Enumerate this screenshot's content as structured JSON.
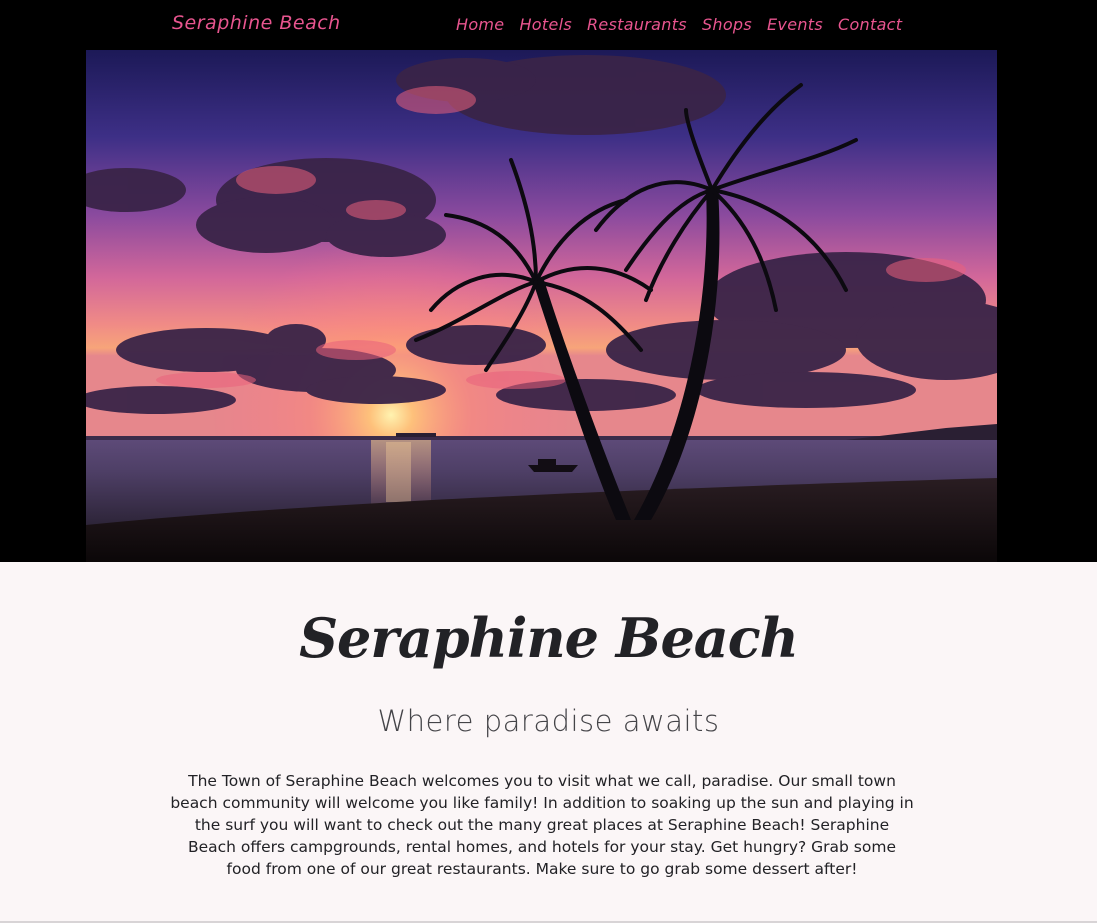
{
  "navbar": {
    "brand": "Seraphine Beach",
    "links": [
      "Home",
      "Hotels",
      "Restaurants",
      "Shops",
      "Events",
      "Contact"
    ]
  },
  "hero": {
    "image": "beach sunset with two palm trees"
  },
  "main": {
    "title": "Seraphine Beach",
    "subtitle": "Where paradise awaits",
    "intro": "The Town of Seraphine Beach welcomes you to visit what we call, paradise. Our small town beach community will welcome you like family! In addition to soaking up the sun and playing in the surf you will want to check out the many great places at Seraphine Beach! Seraphine Beach offers campgrounds, rental homes, and hotels for your stay. Get hungry? Grab some food from one of our great restaurants. Make sure to go grab some dessert after!"
  },
  "colors": {
    "accent": "#e8558f",
    "header_bg": "#000000",
    "page_bg": "#fbf6f7",
    "text": "#222226"
  }
}
